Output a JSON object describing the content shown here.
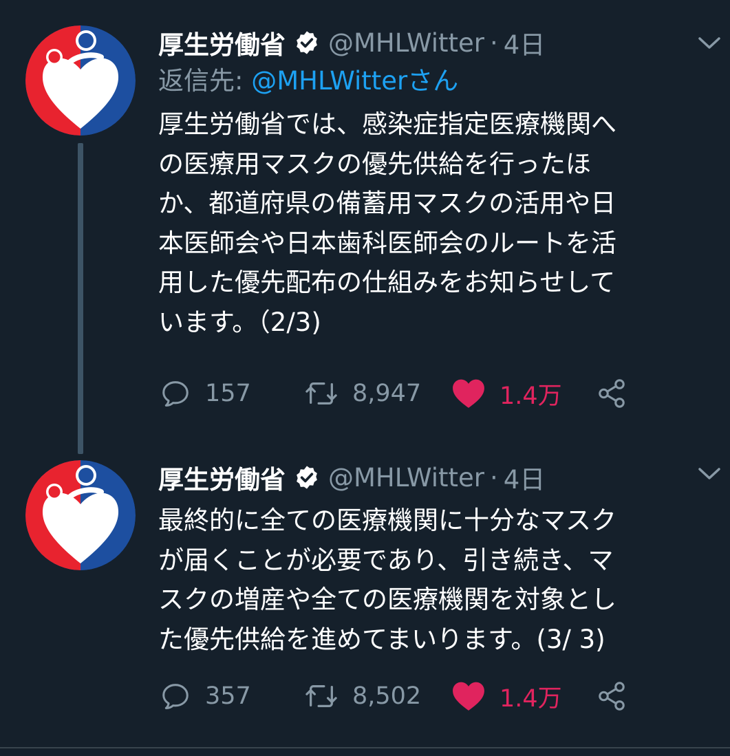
{
  "colors": {
    "background": "#15202b",
    "secondary_text": "#8899a6",
    "link": "#1da1f2",
    "like_active": "#e0245e",
    "thread_line": "#3d5466"
  },
  "tweets": [
    {
      "display_name": "厚生労働省",
      "verified_icon": "verified-badge-icon",
      "handle": "@MHLWitter",
      "separator": "·",
      "time": "4日",
      "reply_prefix": "返信先: ",
      "reply_target": "@MHLWitterさん",
      "text_lines": [
        "厚生労働省では、感染症指定医療機関へ",
        "の医療用マスクの優先供給を行ったほ",
        "か、都道府県の備蓄用マスクの活用や日",
        "本医師会や日本歯科医師会のルートを活",
        "用した優先配布の仕組みをお知らせして",
        "います。（2/3)"
      ],
      "actions": {
        "reply_count": "157",
        "retweet_count": "8,947",
        "like_count": "1.4万"
      }
    },
    {
      "display_name": "厚生労働省",
      "verified_icon": "verified-badge-icon",
      "handle": "@MHLWitter",
      "separator": "·",
      "time": "4日",
      "text_lines": [
        "最終的に全ての医療機関に十分なマスク",
        "が届くことが必要であり、引き続き、マ",
        "スクの増産や全ての医療機関を対象とし",
        "た優先供給を進めてまいります。(3/ 3)"
      ],
      "actions": {
        "reply_count": "357",
        "retweet_count": "8,502",
        "like_count": "1.4万"
      }
    }
  ]
}
